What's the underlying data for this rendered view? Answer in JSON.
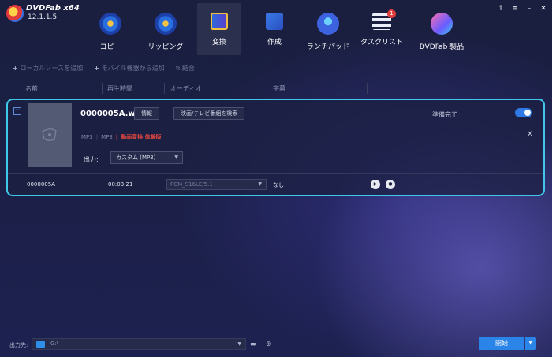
{
  "app": {
    "name": "DVDFab x64",
    "version": "12.1.1.5"
  },
  "window_controls": [
    "↑",
    "≡",
    "–",
    "✕"
  ],
  "nav": [
    {
      "label": "コピー",
      "icon": "copy-disc-icon"
    },
    {
      "label": "リッピング",
      "icon": "ripper-disc-icon"
    },
    {
      "label": "変換",
      "icon": "converter-film-icon",
      "active": true
    },
    {
      "label": "作成",
      "icon": "creator-disc-icon"
    },
    {
      "label": "ランチパッド",
      "icon": "launchpad-rocket-icon"
    },
    {
      "label": "タスクリスト",
      "icon": "task-list-icon",
      "badge": "1"
    },
    {
      "label": "DVDFab 製品",
      "icon": "products-icon"
    }
  ],
  "toolbar": {
    "add_local": "ローカルソースを追加",
    "add_mobile": "モバイル機器から追加",
    "merge": "結合"
  },
  "columns": {
    "name": "名前",
    "duration": "再生時間",
    "audio": "オーディオ",
    "subtitle": "字幕"
  },
  "task": {
    "filename": "0000005A.wav",
    "info_button": "情報",
    "search_button": "映画/テレビ番組を検索",
    "meta_format1": "MP3",
    "meta_format2": "MP3",
    "trial_notice": "動画変換 体験版",
    "output_label": "出力:",
    "output_value": "カスタム (MP3)",
    "status": "準備完了",
    "toggle_on": true,
    "row": {
      "title": "0000005A",
      "duration": "00:03:21",
      "audio_track": "PCM_S16LE/5.1",
      "subtitle": "なし"
    }
  },
  "bottom": {
    "dest_label": "出力先:",
    "dest_path": "G:\\",
    "start_button": "開始"
  }
}
